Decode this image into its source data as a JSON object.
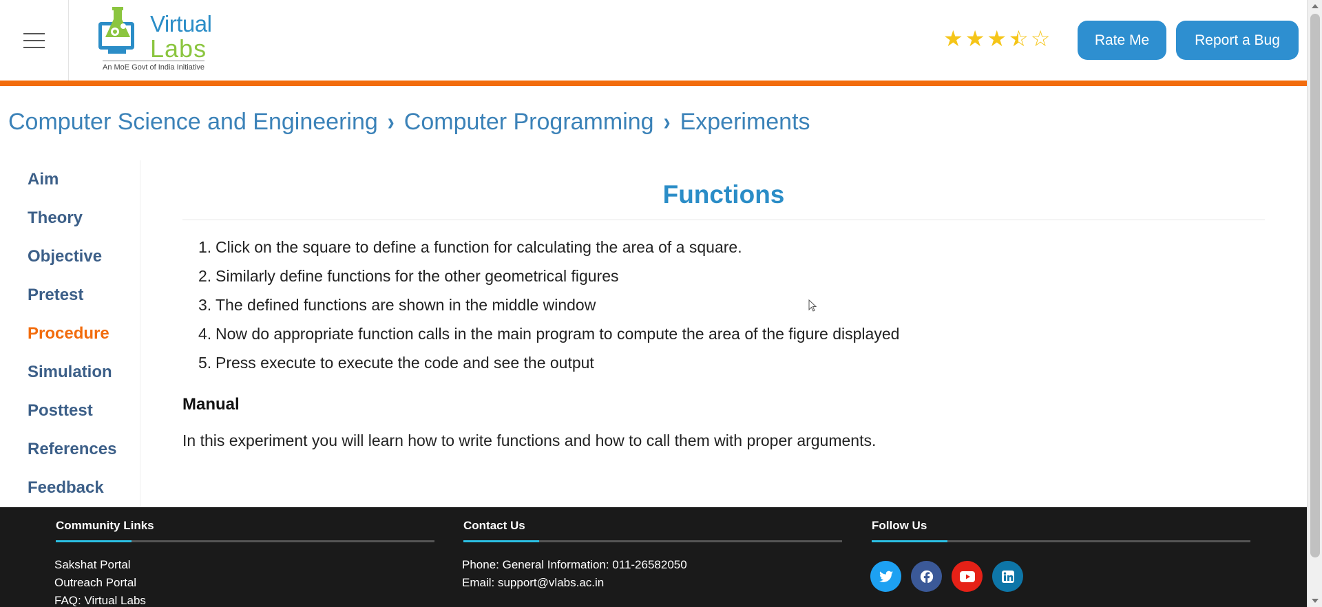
{
  "header": {
    "menu_icon": "hamburger-icon",
    "logo": {
      "word1": "Virtual",
      "word2": "Labs",
      "tagline": "An MoE Govt of India Initiative"
    },
    "rating": {
      "value": 3.5,
      "max": 5,
      "star_color": "#f5c518"
    },
    "rate_label": "Rate Me",
    "bug_label": "Report a Bug",
    "accent_color": "#f26c0d",
    "button_color": "#2e8fd0"
  },
  "breadcrumb": {
    "items": [
      "Computer Science and Engineering",
      "Computer Programming",
      "Experiments"
    ],
    "separator_icon": "chevron-right-icon"
  },
  "sidebar": {
    "items": [
      "Aim",
      "Theory",
      "Objective",
      "Pretest",
      "Procedure",
      "Simulation",
      "Posttest",
      "References",
      "Feedback"
    ],
    "active": "Procedure"
  },
  "main": {
    "title": "Functions",
    "steps": [
      "Click on the square to define a function for calculating the area of a square.",
      "Similarly define functions for the other geometrical figures",
      "The defined functions are shown in the middle window",
      "Now do appropriate function calls in the main program to compute the area of the figure displayed",
      "Press execute to execute the code and see the output"
    ],
    "manual_heading": "Manual",
    "manual_text": "In this experiment you will learn how to write functions and how to call them with proper arguments."
  },
  "footer": {
    "community": {
      "heading": "Community Links",
      "links": [
        "Sakshat Portal",
        "Outreach Portal",
        "FAQ: Virtual Labs"
      ]
    },
    "contact": {
      "heading": "Contact Us",
      "phone": "Phone: General Information: 011-26582050",
      "email": "Email: support@vlabs.ac.in"
    },
    "follow": {
      "heading": "Follow Us",
      "icons": [
        {
          "name": "twitter-icon",
          "color": "#1da1f2",
          "glyph": "t"
        },
        {
          "name": "facebook-icon",
          "color": "#3b5998",
          "glyph": "f"
        },
        {
          "name": "youtube-icon",
          "color": "#e62117",
          "glyph": "▶"
        },
        {
          "name": "linkedin-icon",
          "color": "#0e76a8",
          "glyph": "in"
        }
      ]
    }
  }
}
